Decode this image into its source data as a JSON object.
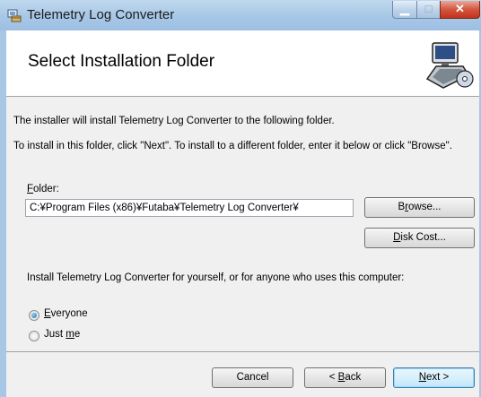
{
  "window": {
    "title": "Telemetry Log Converter",
    "min_glyph": "▁",
    "max_glyph": "□",
    "close_glyph": "✕"
  },
  "banner": {
    "title": "Select Installation Folder"
  },
  "body": {
    "intro": "The installer will install Telemetry Log Converter to the following folder.",
    "instructions": "To install in this folder, click \"Next\". To install to a different folder, enter it below or click \"Browse\".",
    "folder_label": "older:",
    "folder_label_accel": "F",
    "folder_value": "C:¥Program Files (x86)¥Futaba¥Telemetry Log Converter¥",
    "scope_prompt": "Install Telemetry Log Converter for yourself, or for anyone who uses this computer:"
  },
  "buttons": {
    "browse_pre": "B",
    "browse_accel": "r",
    "browse_post": "owse...",
    "diskcost_accel": "D",
    "diskcost_post": "isk Cost...",
    "cancel": "Cancel",
    "back_pre": "< ",
    "back_accel": "B",
    "back_post": "ack",
    "next_accel": "N",
    "next_post": "ext >"
  },
  "options": {
    "everyone_accel": "E",
    "everyone_post": "veryone",
    "justme_pre": "Just ",
    "justme_accel": "m",
    "justme_post": "e",
    "selected": "Everyone"
  },
  "colors": {
    "titlebar": "#a7c7e6",
    "close_button": "#c0331c",
    "dialog_background": "#f0f0f0",
    "default_button_border": "#3c7fb1"
  }
}
